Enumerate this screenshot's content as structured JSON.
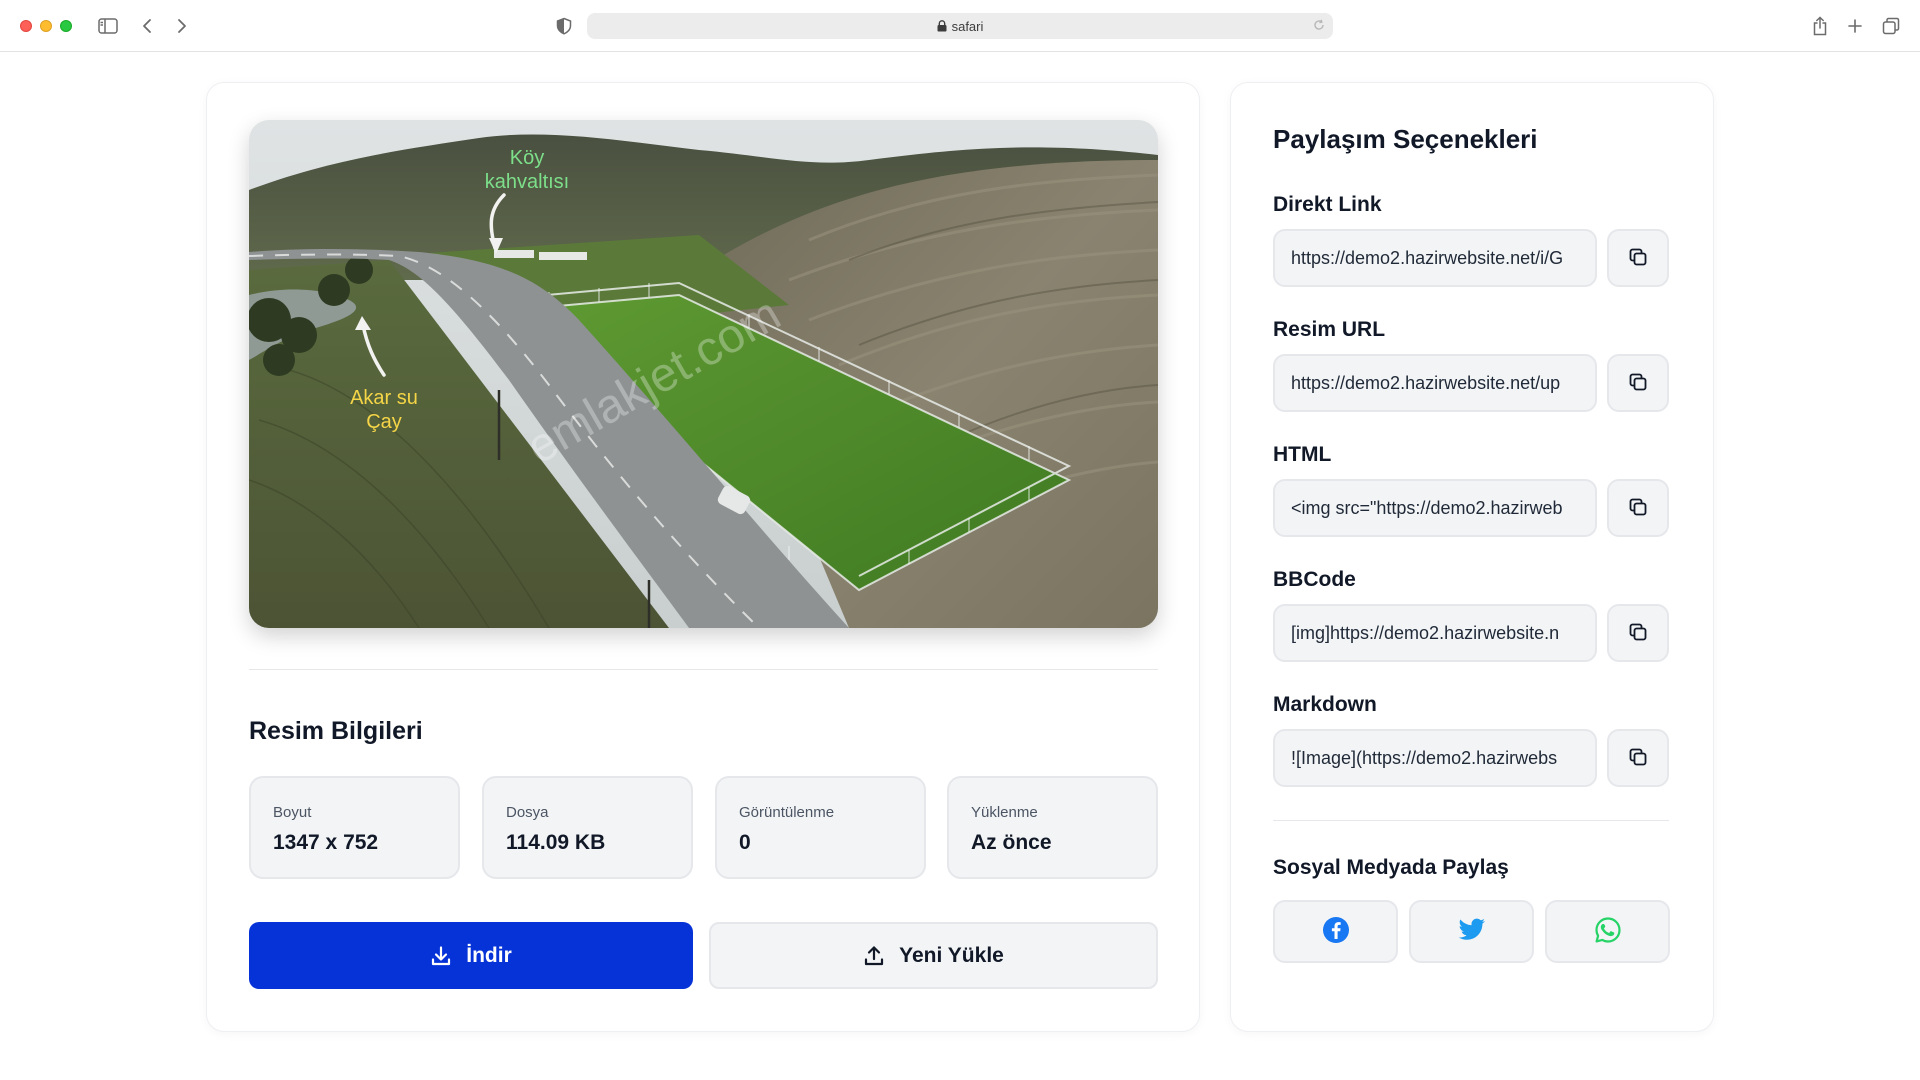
{
  "browser": {
    "url": "safari",
    "icons": [
      "sidebar-icon",
      "back-icon",
      "forward-icon",
      "shield-icon",
      "lock-icon",
      "reload-icon",
      "share-icon",
      "new-tab-icon",
      "tabs-overview-icon"
    ]
  },
  "image": {
    "overlay_labels": {
      "village": [
        "Köy",
        "kahvaltısı"
      ],
      "stream": [
        "Akar su",
        "Çay"
      ],
      "watermark": "emlakjet.com"
    }
  },
  "info": {
    "title": "Resim Bilgileri",
    "items": [
      {
        "label": "Boyut",
        "value": "1347 x 752"
      },
      {
        "label": "Dosya",
        "value": "114.09 KB"
      },
      {
        "label": "Görüntülenme",
        "value": "0"
      },
      {
        "label": "Yüklenme",
        "value": "Az önce"
      }
    ]
  },
  "actions": {
    "download_label": "İndir",
    "upload_label": "Yeni Yükle",
    "download_icon": "download-icon",
    "upload_icon": "upload-icon"
  },
  "sharing": {
    "title": "Paylaşım Seçenekleri",
    "fields": [
      {
        "label": "Direkt Link",
        "value": "https://demo2.hazirwebsite.net/i/G"
      },
      {
        "label": "Resim URL",
        "value": "https://demo2.hazirwebsite.net/up"
      },
      {
        "label": "HTML",
        "value": "<img src=\"https://demo2.hazirweb"
      },
      {
        "label": "BBCode",
        "value": "[img]https://demo2.hazirwebsite.n"
      },
      {
        "label": "Markdown",
        "value": "![Image](https://demo2.hazirwebs"
      }
    ],
    "copy_icon": "copy-icon",
    "social_title": "Sosyal Medyada Paylaş",
    "social": [
      {
        "name": "facebook",
        "color": "#1877f2"
      },
      {
        "name": "twitter",
        "color": "#1d9bf0"
      },
      {
        "name": "whatsapp",
        "color": "#25d366"
      }
    ]
  },
  "colors": {
    "primary": "#0633d8",
    "village_label": "#7ddf8a",
    "stream_label": "#f5d547"
  }
}
